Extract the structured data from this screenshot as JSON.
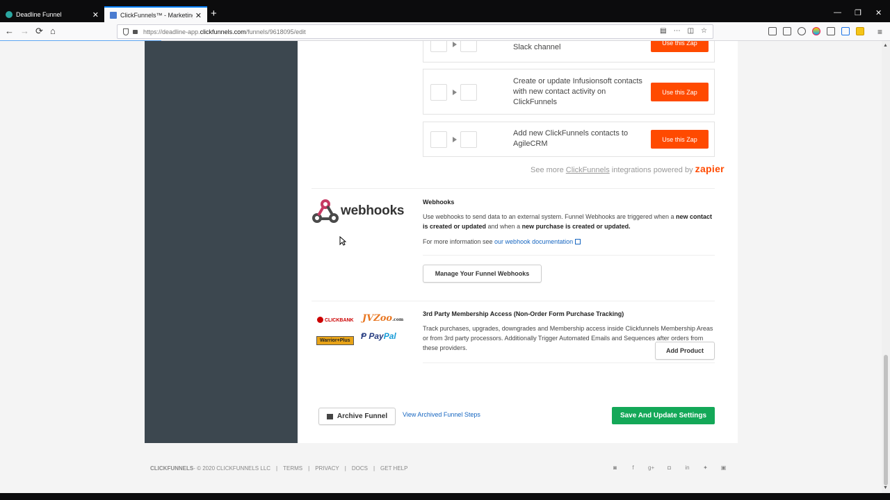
{
  "browser": {
    "tabs": [
      {
        "title": "Deadline Funnel",
        "close": "✕"
      },
      {
        "title": "ClickFunnels™ - Marketing Fun",
        "close": "✕"
      }
    ],
    "new_tab": "+",
    "window": {
      "minimize": "—",
      "restore": "❐",
      "close": "✕"
    },
    "nav": {
      "back": "←",
      "forward": "→",
      "reload": "⟳",
      "home": "⌂"
    },
    "url_prefix": "https://deadline-app.",
    "url_domain": "clickfunnels.com",
    "url_path": "/funnels/9618095/edit",
    "url_actions": [
      "⋯",
      "☆"
    ],
    "menu": "≡"
  },
  "zaps": [
    {
      "text": "Post new ClickFunnels purchases to a Slack channel",
      "button": "Use this Zap"
    },
    {
      "text": "Create or update Infusionsoft contacts with new contact activity on ClickFunnels",
      "button": "Use this Zap"
    },
    {
      "text": "Add new ClickFunnels contacts to AgileCRM",
      "button": "Use this Zap"
    }
  ],
  "see_more": {
    "prefix": "See more ",
    "link": "ClickFunnels",
    "suffix": " integrations powered by ",
    "brand": "zapier"
  },
  "webhooks": {
    "logo_text": "webhooks",
    "title": "Webhooks",
    "desc_1": "Use webhooks to send data to an external system. Funnel Webhooks are triggered when a ",
    "desc_b1": "new contact is created or updated",
    "desc_2": " and when a ",
    "desc_b2": "new purchase is created or updated.",
    "more_prefix": "For more information see ",
    "more_link": "our webhook documentation",
    "manage_button": "Manage Your Funnel Webhooks"
  },
  "membership": {
    "title": "3rd Party Membership Access (Non-Order Form Purchase Tracking)",
    "desc": "Track purchases, upgrades, downgrades and Membership access inside Clickfunnels Membership Areas or from 3rd party processors. Additionally Trigger Automated Emails and Sequences after orders from these providers.",
    "add_button": "Add Product",
    "logos": {
      "clickbank": "CLICKBANK",
      "jvzoo": "JVZoo",
      "jvzoo_tld": ".com",
      "warriorplus": "Warrior+Plus",
      "paypal_pay": "Pay",
      "paypal_pal": "Pal"
    }
  },
  "actions": {
    "archive": "Archive Funnel",
    "view_archived": "View Archived Funnel Steps",
    "save": "Save And Update Settings"
  },
  "footer": {
    "brand": "CLICKFUNNELS",
    "copyright": " - © 2020 CLICKFUNNELS LLC",
    "links": [
      "TERMS",
      "PRIVACY",
      "DOCS",
      "GET HELP"
    ],
    "separator": "|",
    "social": [
      "rss-icon",
      "facebook-icon",
      "google-plus-icon",
      "instagram-icon",
      "linkedin-icon",
      "twitter-icon",
      "youtube-icon"
    ]
  },
  "colors": {
    "zap_button": "#ff4a00",
    "save_button": "#14a858",
    "sidebar": "#3c474f",
    "link": "#1565c0"
  }
}
